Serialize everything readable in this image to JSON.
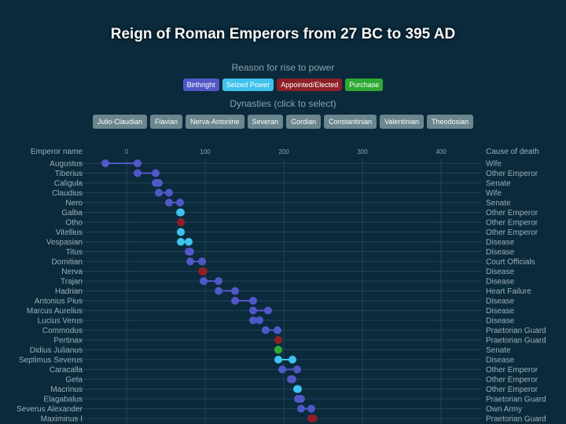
{
  "header": {
    "title": "Reign of Roman Emperors from 27 BC to 395 AD"
  },
  "legend": {
    "title": "Reason for rise to power",
    "items": [
      {
        "label": "Birthright",
        "color": "#5158c6"
      },
      {
        "label": "Seized Power",
        "color": "#3ec2ee"
      },
      {
        "label": "Appointed/Elected",
        "color": "#8e1f28"
      },
      {
        "label": "Purchase",
        "color": "#2eaa33"
      }
    ]
  },
  "dynasties": {
    "title": "Dynasties (click to select)",
    "items": [
      "Julio-Claudian",
      "Flavian",
      "Nerva-Antonine",
      "Severan",
      "Gordian",
      "Constantinian",
      "Valentinian",
      "Theodosian"
    ]
  },
  "chart_data": {
    "type": "dumbbell",
    "left_header": "Emperor name",
    "right_header": "Cause of death",
    "x_ticks": [
      0,
      100,
      200,
      300,
      400
    ],
    "xlim": [
      -30,
      430
    ],
    "grid": true,
    "rows": [
      {
        "name": "Augustus",
        "start": -27,
        "end": 14,
        "rise": "Birthright",
        "death": "Wife"
      },
      {
        "name": "Tiberius",
        "start": 14,
        "end": 37,
        "rise": "Birthright",
        "death": "Other Emperor"
      },
      {
        "name": "Caligula",
        "start": 37,
        "end": 41,
        "rise": "Birthright",
        "death": "Senate"
      },
      {
        "name": "Claudius",
        "start": 41,
        "end": 54,
        "rise": "Birthright",
        "death": "Wife"
      },
      {
        "name": "Nero",
        "start": 54,
        "end": 68,
        "rise": "Birthright",
        "death": "Senate"
      },
      {
        "name": "Galba",
        "start": 68,
        "end": 69,
        "rise": "Seized Power",
        "death": "Other Emperor"
      },
      {
        "name": "Otho",
        "start": 69,
        "end": 69,
        "rise": "Appointed/Elected",
        "death": "Other Emperor"
      },
      {
        "name": "Vitellius",
        "start": 69,
        "end": 69,
        "rise": "Seized Power",
        "death": "Other Emperor"
      },
      {
        "name": "Vespasian",
        "start": 69,
        "end": 79,
        "rise": "Seized Power",
        "death": "Disease"
      },
      {
        "name": "Titus",
        "start": 79,
        "end": 81,
        "rise": "Birthright",
        "death": "Disease"
      },
      {
        "name": "Domitian",
        "start": 81,
        "end": 96,
        "rise": "Birthright",
        "death": "Court Officials"
      },
      {
        "name": "Nerva",
        "start": 96,
        "end": 98,
        "rise": "Appointed/Elected",
        "death": "Disease"
      },
      {
        "name": "Trajan",
        "start": 98,
        "end": 117,
        "rise": "Birthright",
        "death": "Disease"
      },
      {
        "name": "Hadrian",
        "start": 117,
        "end": 138,
        "rise": "Birthright",
        "death": "Heart Failure"
      },
      {
        "name": "Antonius Pius",
        "start": 138,
        "end": 161,
        "rise": "Birthright",
        "death": "Disease"
      },
      {
        "name": "Marcus Aurelius",
        "start": 161,
        "end": 180,
        "rise": "Birthright",
        "death": "Disease"
      },
      {
        "name": "Lucius Verus",
        "start": 161,
        "end": 169,
        "rise": "Birthright",
        "death": "Disease"
      },
      {
        "name": "Commodus",
        "start": 177,
        "end": 192,
        "rise": "Birthright",
        "death": "Praetorian Guard"
      },
      {
        "name": "Pertinax",
        "start": 193,
        "end": 193,
        "rise": "Appointed/Elected",
        "death": "Praetorian Guard"
      },
      {
        "name": "Didius Julianus",
        "start": 193,
        "end": 193,
        "rise": "Purchase",
        "death": "Senate"
      },
      {
        "name": "Septimus Severus",
        "start": 193,
        "end": 211,
        "rise": "Seized Power",
        "death": "Disease"
      },
      {
        "name": "Caracalla",
        "start": 198,
        "end": 217,
        "rise": "Birthright",
        "death": "Other Emperor"
      },
      {
        "name": "Geta",
        "start": 209,
        "end": 211,
        "rise": "Birthright",
        "death": "Other Emperor"
      },
      {
        "name": "Macrinus",
        "start": 217,
        "end": 218,
        "rise": "Seized Power",
        "death": "Other Emperor"
      },
      {
        "name": "Elagabalus",
        "start": 218,
        "end": 222,
        "rise": "Birthright",
        "death": "Praetorian Guard"
      },
      {
        "name": "Severus Alexander",
        "start": 222,
        "end": 235,
        "rise": "Birthright",
        "death": "Own Army"
      },
      {
        "name": "Maximinus I",
        "start": 235,
        "end": 238,
        "rise": "Appointed/Elected",
        "death": "Praetorian Guard"
      }
    ]
  }
}
